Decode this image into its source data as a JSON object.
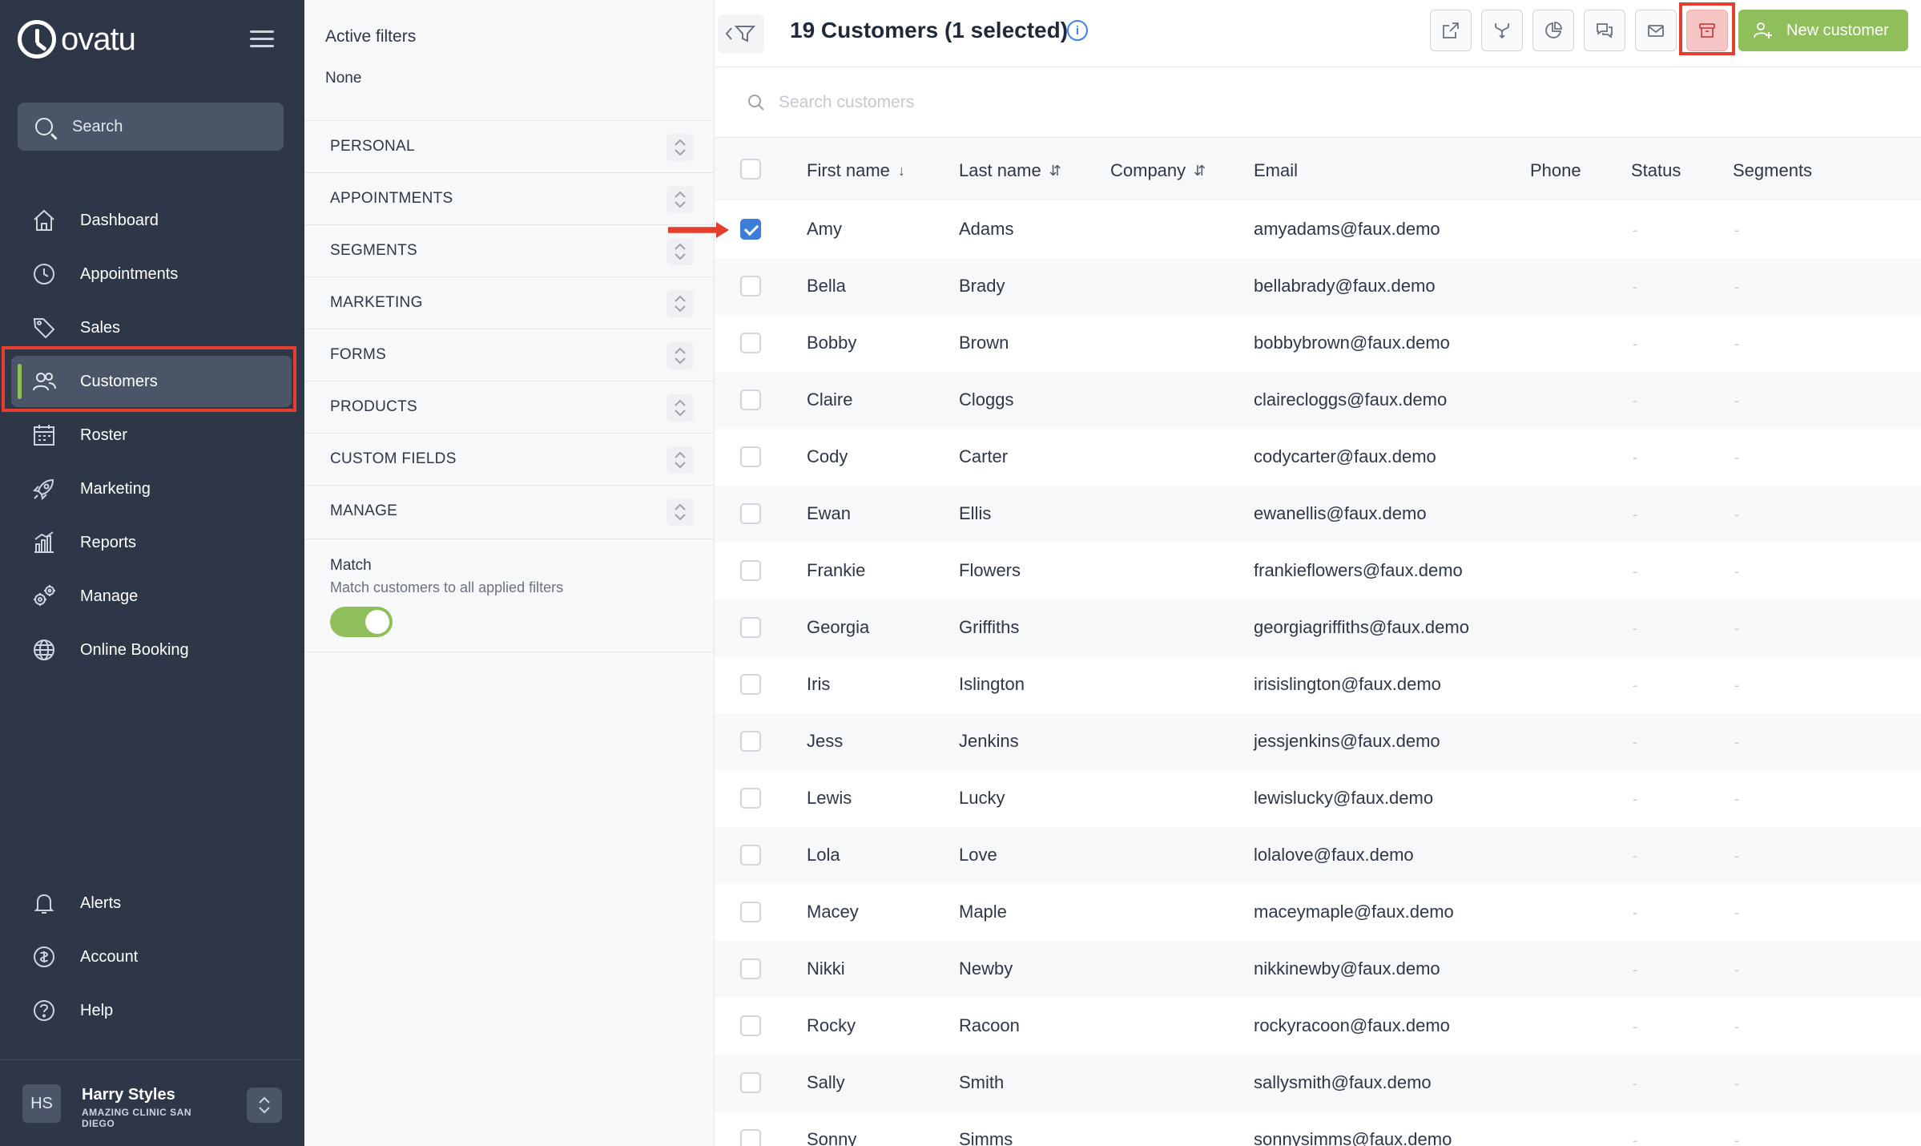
{
  "brand": {
    "name": "ovatu"
  },
  "sidebar": {
    "search_label": "Search",
    "items": [
      {
        "label": "Dashboard",
        "icon": "home-icon"
      },
      {
        "label": "Appointments",
        "icon": "clock-icon"
      },
      {
        "label": "Sales",
        "icon": "tag-icon"
      },
      {
        "label": "Customers",
        "icon": "users-icon",
        "active": true
      },
      {
        "label": "Roster",
        "icon": "calendar-icon"
      },
      {
        "label": "Marketing",
        "icon": "rocket-icon"
      },
      {
        "label": "Reports",
        "icon": "bar-chart-icon"
      },
      {
        "label": "Manage",
        "icon": "gears-icon"
      },
      {
        "label": "Online Booking",
        "icon": "globe-icon"
      }
    ],
    "bottom_items": [
      {
        "label": "Alerts",
        "icon": "bell-icon"
      },
      {
        "label": "Account",
        "icon": "account-icon"
      },
      {
        "label": "Help",
        "icon": "help-icon"
      }
    ],
    "user": {
      "initials": "HS",
      "name": "Harry Styles",
      "org": "AMAZING CLINIC SAN DIEGO"
    }
  },
  "filters": {
    "active_title": "Active filters",
    "active_value": "None",
    "groups": [
      "PERSONAL",
      "APPOINTMENTS",
      "SEGMENTS",
      "MARKETING",
      "FORMS",
      "PRODUCTS",
      "CUSTOM FIELDS",
      "MANAGE"
    ],
    "match_title": "Match",
    "match_desc": "Match customers to all applied filters",
    "match_enabled": true
  },
  "header": {
    "title": "19 Customers (1 selected)",
    "info": "i",
    "new_customer_label": "New customer"
  },
  "search": {
    "placeholder": "Search customers",
    "value": ""
  },
  "table": {
    "columns": {
      "first": "First name",
      "last": "Last name",
      "company": "Company",
      "email": "Email",
      "phone": "Phone",
      "status": "Status",
      "segments": "Segments"
    },
    "sort_first": "↓",
    "sort_other": "⇵",
    "rows": [
      {
        "first": "Amy",
        "last": "Adams",
        "email": "amyadams@faux.demo",
        "status": "-",
        "segments": "-",
        "selected": true
      },
      {
        "first": "Bella",
        "last": "Brady",
        "email": "bellabrady@faux.demo",
        "status": "-",
        "segments": "-"
      },
      {
        "first": "Bobby",
        "last": "Brown",
        "email": "bobbybrown@faux.demo",
        "status": "-",
        "segments": "-"
      },
      {
        "first": "Claire",
        "last": "Cloggs",
        "email": "clairecloggs@faux.demo",
        "status": "-",
        "segments": "-"
      },
      {
        "first": "Cody",
        "last": "Carter",
        "email": "codycarter@faux.demo",
        "status": "-",
        "segments": "-"
      },
      {
        "first": "Ewan",
        "last": "Ellis",
        "email": "ewanellis@faux.demo",
        "status": "-",
        "segments": "-"
      },
      {
        "first": "Frankie",
        "last": "Flowers",
        "email": "frankieflowers@faux.demo",
        "status": "-",
        "segments": "-"
      },
      {
        "first": "Georgia",
        "last": "Griffiths",
        "email": "georgiagriffiths@faux.demo",
        "status": "-",
        "segments": "-"
      },
      {
        "first": "Iris",
        "last": "Islington",
        "email": "irisislington@faux.demo",
        "status": "-",
        "segments": "-"
      },
      {
        "first": "Jess",
        "last": "Jenkins",
        "email": "jessjenkins@faux.demo",
        "status": "-",
        "segments": "-"
      },
      {
        "first": "Lewis",
        "last": "Lucky",
        "email": "lewislucky@faux.demo",
        "status": "-",
        "segments": "-"
      },
      {
        "first": "Lola",
        "last": "Love",
        "email": "lolalove@faux.demo",
        "status": "-",
        "segments": "-"
      },
      {
        "first": "Macey",
        "last": "Maple",
        "email": "maceymaple@faux.demo",
        "status": "-",
        "segments": "-"
      },
      {
        "first": "Nikki",
        "last": "Newby",
        "email": "nikkinewby@faux.demo",
        "status": "-",
        "segments": "-"
      },
      {
        "first": "Rocky",
        "last": "Racoon",
        "email": "rockyracoon@faux.demo",
        "status": "-",
        "segments": "-"
      },
      {
        "first": "Sally",
        "last": "Smith",
        "email": "sallysmith@faux.demo",
        "status": "-",
        "segments": "-"
      },
      {
        "first": "Sonny",
        "last": "Simms",
        "email": "sonnysimms@faux.demo",
        "status": "-",
        "segments": "-"
      }
    ]
  },
  "colors": {
    "sidebar": "#2d3748",
    "accent": "#8fbf5a",
    "highlight": "#e53e2f",
    "checkbox": "#3b7dd8"
  }
}
